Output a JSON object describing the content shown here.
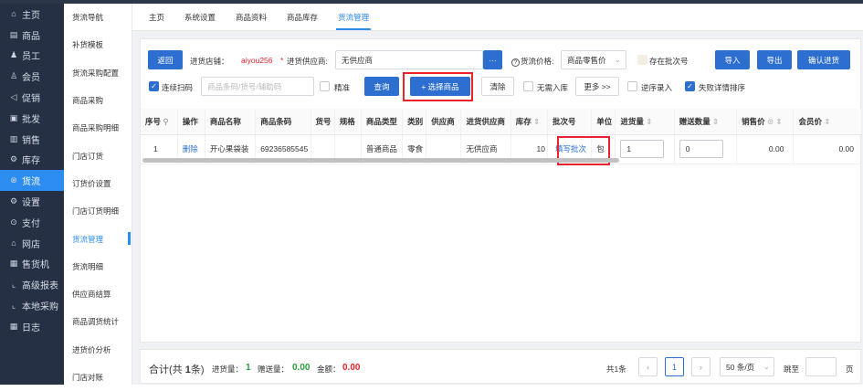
{
  "sidebar": {
    "items": [
      {
        "icon": "home-icon",
        "glyph": "⌂",
        "label": "主页"
      },
      {
        "icon": "goods-icon",
        "glyph": "▤",
        "label": "商品"
      },
      {
        "icon": "staff-icon",
        "glyph": "♟",
        "label": "员工"
      },
      {
        "icon": "member-icon",
        "glyph": "♙",
        "label": "会员"
      },
      {
        "icon": "promo-icon",
        "glyph": "◁",
        "label": "促销"
      },
      {
        "icon": "wholesale-icon",
        "glyph": "▣",
        "label": "批发"
      },
      {
        "icon": "sales-icon",
        "glyph": "▥",
        "label": "销售"
      },
      {
        "icon": "stock-icon",
        "glyph": "⚙",
        "label": "库存"
      },
      {
        "icon": "flow-icon",
        "glyph": "⊗",
        "label": "货流",
        "active": true
      },
      {
        "icon": "settings-icon",
        "glyph": "⚙",
        "label": "设置"
      },
      {
        "icon": "payment-icon",
        "glyph": "⊙",
        "label": "支付"
      },
      {
        "icon": "store-icon",
        "glyph": "⌂",
        "label": "网店"
      },
      {
        "icon": "vending-icon",
        "glyph": "▦",
        "label": "售货机"
      },
      {
        "icon": "report-icon",
        "glyph": "⌞",
        "label": "高级报表"
      },
      {
        "icon": "local-purchase-icon",
        "glyph": "⌞",
        "label": "本地采购"
      },
      {
        "icon": "log-icon",
        "glyph": "▦",
        "label": "日志"
      }
    ]
  },
  "subnav": {
    "items": [
      {
        "label": "货流导航"
      },
      {
        "label": "补货模板"
      },
      {
        "label": "货流采购配置"
      },
      {
        "label": "商品采购"
      },
      {
        "label": "商品采购明细"
      },
      {
        "label": "门店订货"
      },
      {
        "label": "订货价设置"
      },
      {
        "label": "门店订货明细"
      },
      {
        "label": "货流管理",
        "active": true
      },
      {
        "label": "货流明细"
      },
      {
        "label": "供应商结算"
      },
      {
        "label": "商品调货统计"
      },
      {
        "label": "进货价分析"
      },
      {
        "label": "门店对账"
      }
    ]
  },
  "tabs": [
    {
      "label": "主页"
    },
    {
      "label": "系统设置"
    },
    {
      "label": "商品资料"
    },
    {
      "label": "商品库存"
    },
    {
      "label": "货流管理",
      "active": true
    }
  ],
  "toolbar": {
    "back": "返回",
    "store_label": "进货店铺：",
    "store_value": "aiyou256",
    "required_mark": "*",
    "supplier_label": "进货供应商:",
    "supplier_value": "无供应商",
    "more_dots": "···",
    "price_label": "货流价格:",
    "price_value": "商品零售价",
    "batch_exists": "存在批次号",
    "import": "导入",
    "export": "导出",
    "confirm": "确认进货"
  },
  "row2": {
    "continuous_scan": "连续扫码",
    "search_placeholder": "商品条码/货号/辅助码",
    "exact": "精准",
    "query": "查询",
    "choose": "+ 选择商品",
    "clear": "清除",
    "no_stock": "无需入库",
    "more": "更多 >>",
    "reverse_entry": "逆序录入",
    "fail_sort": "失败详情排序"
  },
  "table": {
    "headers": [
      "序号",
      "操作",
      "商品名称",
      "商品条码",
      "货号",
      "规格",
      "商品类型",
      "类别",
      "供应商",
      "进货供应商",
      "库存",
      "批次号",
      "单位",
      "进货量",
      "赠送数量",
      "销售价",
      "会员价"
    ],
    "rows": [
      {
        "no": "1",
        "op": "删除",
        "name": "开心果袋装",
        "barcode": "69236585545",
        "item_no": "",
        "spec": "",
        "type": "普通商品",
        "category": "零食",
        "supplier": "",
        "in_supplier": "无供应商",
        "stock": "10",
        "batch": "填写批次",
        "unit": "包",
        "qty": "1",
        "gift": "0",
        "sale_price": "0.00",
        "member_price": "0.00"
      }
    ]
  },
  "footer": {
    "total_prefix": "合计(共",
    "total_count": "1",
    "total_suffix": "条)",
    "qty_label": "进货量：",
    "qty_value": "1",
    "gift_label": "赠送量：",
    "gift_value": "0.00",
    "amount_label": "金额：",
    "amount_value": "0.00",
    "records": "共1条",
    "page_current": "1",
    "page_size": "50 条/页",
    "goto": "跳至",
    "page_unit": "页"
  },
  "colors": {
    "primary": "#2d6fd1",
    "highlight": "#e8232b",
    "sidebar": "#253044",
    "active": "#2d8cf0",
    "green": "#2a9d3a"
  }
}
